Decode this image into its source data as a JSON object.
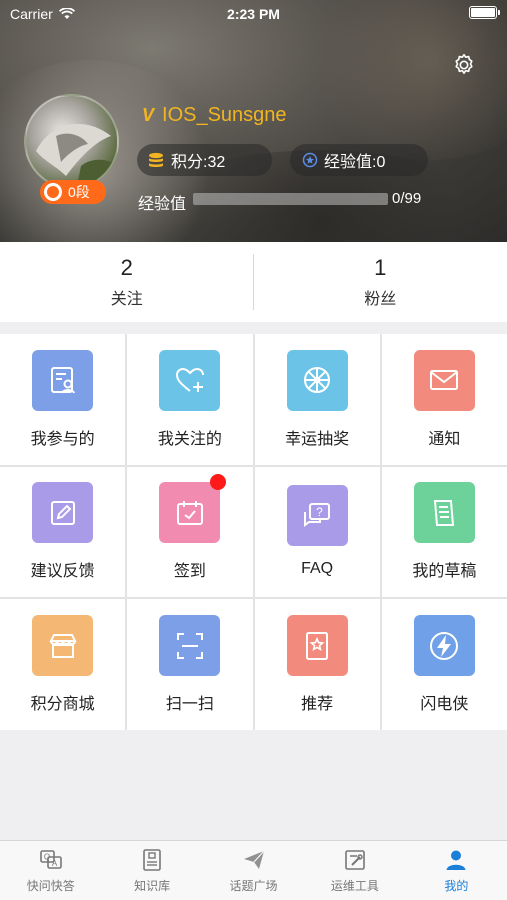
{
  "status_bar": {
    "carrier": "Carrier",
    "time": "2:23 PM"
  },
  "profile": {
    "vip_mark": "V",
    "username": "IOS_Sunsgne",
    "level": "0段",
    "points_label": "积分:32",
    "exp_label": "经验值:0",
    "exp_bar_label": "经验值",
    "exp_value": "0/99",
    "exp_progress": 0
  },
  "stats": [
    {
      "count": "2",
      "label": "关注"
    },
    {
      "count": "1",
      "label": "粉丝"
    }
  ],
  "menu": [
    {
      "label": "我参与的",
      "icon": "profile-card-icon",
      "color": "#7d9fe8"
    },
    {
      "label": "我关注的",
      "icon": "heart-plus-icon",
      "color": "#6cc3e8"
    },
    {
      "label": "幸运抽奖",
      "icon": "lottery-wheel-icon",
      "color": "#6cc3e8"
    },
    {
      "label": "通知",
      "icon": "envelope-icon",
      "color": "#f28b7d"
    },
    {
      "label": "建议反馈",
      "icon": "edit-icon",
      "color": "#a99be8"
    },
    {
      "label": "签到",
      "icon": "calendar-check-icon",
      "color": "#f28bb0",
      "badge": true
    },
    {
      "label": "FAQ",
      "icon": "question-chat-icon",
      "color": "#a99be8"
    },
    {
      "label": "我的草稿",
      "icon": "document-icon",
      "color": "#6dd19a"
    },
    {
      "label": "积分商城",
      "icon": "store-icon",
      "color": "#f5b774"
    },
    {
      "label": "扫一扫",
      "icon": "scan-icon",
      "color": "#7d9fe8"
    },
    {
      "label": "推荐",
      "icon": "star-book-icon",
      "color": "#f28b7d"
    },
    {
      "label": "闪电侠",
      "icon": "lightning-icon",
      "color": "#6fa0e8"
    }
  ],
  "tabs": [
    {
      "label": "快问快答",
      "icon": "qa-icon"
    },
    {
      "label": "知识库",
      "icon": "knowledge-icon"
    },
    {
      "label": "话题广场",
      "icon": "paper-plane-icon"
    },
    {
      "label": "运维工具",
      "icon": "tools-icon"
    },
    {
      "label": "我的",
      "icon": "user-icon",
      "active": true
    }
  ],
  "colors": {
    "accent": "#1a7fd8",
    "gold": "#f2b521",
    "badge": "#ff6a1a"
  }
}
